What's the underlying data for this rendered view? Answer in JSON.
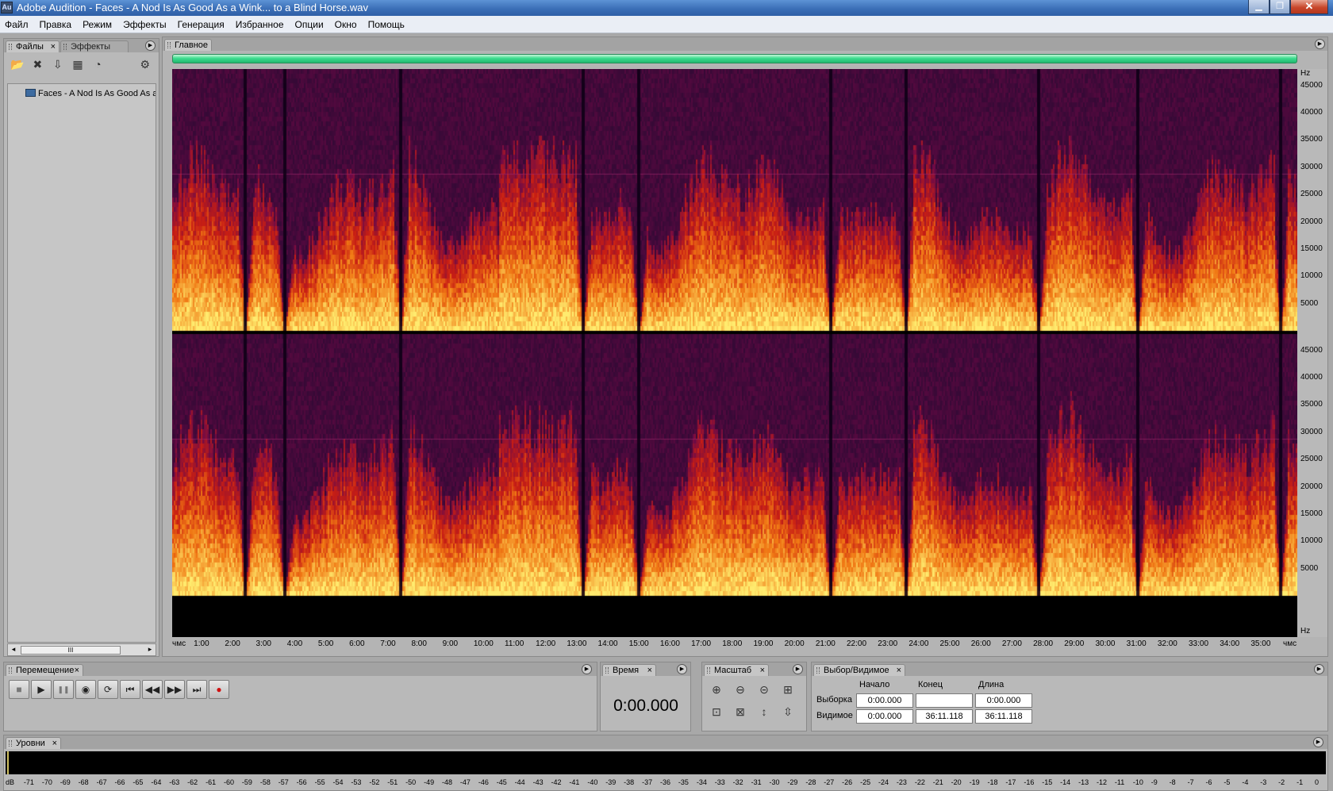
{
  "window": {
    "icon": "Au",
    "title": "Adobe Audition - Faces - A Nod Is As Good As a Wink... to a Blind Horse.wav",
    "min_icon": "minimize-icon",
    "max_icon": "maximize-icon",
    "close_icon": "close-icon"
  },
  "menu": [
    "Файл",
    "Правка",
    "Режим",
    "Эффекты",
    "Генерация",
    "Избранное",
    "Опции",
    "Окно",
    "Помощь"
  ],
  "files_panel": {
    "tab_files": "Файлы",
    "tab_effects": "Эффекты",
    "close": "×",
    "toolbar_icons": [
      "open-file-icon",
      "close-file-icon",
      "import-icon",
      "insert-icon",
      "autoplay-icon",
      "options-icon"
    ],
    "file_name": "Faces - A Nod Is As Good As a Wink... to a Blind Horse.wav",
    "scroll_thumb": "III",
    "scroll_left": "◂",
    "scroll_right": "▸"
  },
  "main_panel": {
    "tab": "Главное",
    "hz_unit": "Hz",
    "hz_labels": [
      "45000",
      "40000",
      "35000",
      "30000",
      "25000",
      "20000",
      "15000",
      "10000",
      "5000"
    ],
    "time_start": "чмс",
    "time_end": "чмс",
    "time_labels": [
      "1:00",
      "2:00",
      "3:00",
      "4:00",
      "5:00",
      "6:00",
      "7:00",
      "8:00",
      "9:00",
      "10:00",
      "11:00",
      "12:00",
      "13:00",
      "14:00",
      "15:00",
      "16:00",
      "17:00",
      "18:00",
      "19:00",
      "20:00",
      "21:00",
      "22:00",
      "23:00",
      "24:00",
      "25:00",
      "26:00",
      "27:00",
      "28:00",
      "29:00",
      "30:00",
      "31:00",
      "32:00",
      "33:00",
      "34:00",
      "35:00"
    ],
    "total_minutes": 36.19,
    "max_hz": 48000,
    "colors": {
      "progress": "#3ddc8f",
      "spectrum_low": "#2a0a3a",
      "spectrum_mid": "#c02010",
      "spectrum_high": "#ffe060"
    }
  },
  "transport": {
    "tab": "Перемещение",
    "close": "×",
    "buttons": [
      {
        "name": "stop-button",
        "icon": "■"
      },
      {
        "name": "play-button",
        "icon": "▶"
      },
      {
        "name": "pause-button",
        "icon": "❚❚"
      },
      {
        "name": "play-to-end-button",
        "icon": "◉"
      },
      {
        "name": "loop-button",
        "icon": "⟳"
      },
      {
        "name": "go-to-start-button",
        "icon": "⏮"
      },
      {
        "name": "rewind-button",
        "icon": "◀◀"
      },
      {
        "name": "fast-forward-button",
        "icon": "▶▶"
      },
      {
        "name": "go-to-end-button",
        "icon": "⏭"
      },
      {
        "name": "record-button",
        "icon": "●"
      }
    ]
  },
  "time_panel": {
    "tab": "Время",
    "close": "×",
    "value": "0:00.000"
  },
  "zoom_panel": {
    "tab": "Масштаб",
    "close": "×",
    "icons": [
      "zoom-in-horizontal-icon",
      "zoom-out-horizontal-icon",
      "zoom-out-full-icon",
      "zoom-selection-icon",
      "zoom-left-edge-icon",
      "zoom-right-edge-icon",
      "zoom-in-vertical-icon",
      "zoom-out-vertical-icon"
    ]
  },
  "selection_panel": {
    "tab": "Выбор/Видимое",
    "close": "×",
    "col_start": "Начало",
    "col_end": "Конец",
    "col_length": "Длина",
    "row_selection": "Выборка",
    "row_view": "Видимое",
    "selection": {
      "start": "0:00.000",
      "end": "",
      "length": "0:00.000"
    },
    "view": {
      "start": "0:00.000",
      "end": "36:11.118",
      "length": "36:11.118"
    }
  },
  "levels_panel": {
    "tab": "Уровни",
    "close": "×",
    "db_labels": [
      "dB",
      "-71",
      "-70",
      "-69",
      "-68",
      "-67",
      "-66",
      "-65",
      "-64",
      "-63",
      "-62",
      "-61",
      "-60",
      "-59",
      "-58",
      "-57",
      "-56",
      "-55",
      "-54",
      "-53",
      "-52",
      "-51",
      "-50",
      "-49",
      "-48",
      "-47",
      "-46",
      "-45",
      "-44",
      "-43",
      "-42",
      "-41",
      "-40",
      "-39",
      "-38",
      "-37",
      "-36",
      "-35",
      "-34",
      "-33",
      "-32",
      "-31",
      "-30",
      "-29",
      "-28",
      "-27",
      "-26",
      "-25",
      "-24",
      "-23",
      "-22",
      "-21",
      "-20",
      "-19",
      "-18",
      "-17",
      "-16",
      "-15",
      "-14",
      "-13",
      "-12",
      "-11",
      "-10",
      "-9",
      "-8",
      "-7",
      "-6",
      "-5",
      "-4",
      "-3",
      "-2",
      "-1",
      "0"
    ]
  }
}
